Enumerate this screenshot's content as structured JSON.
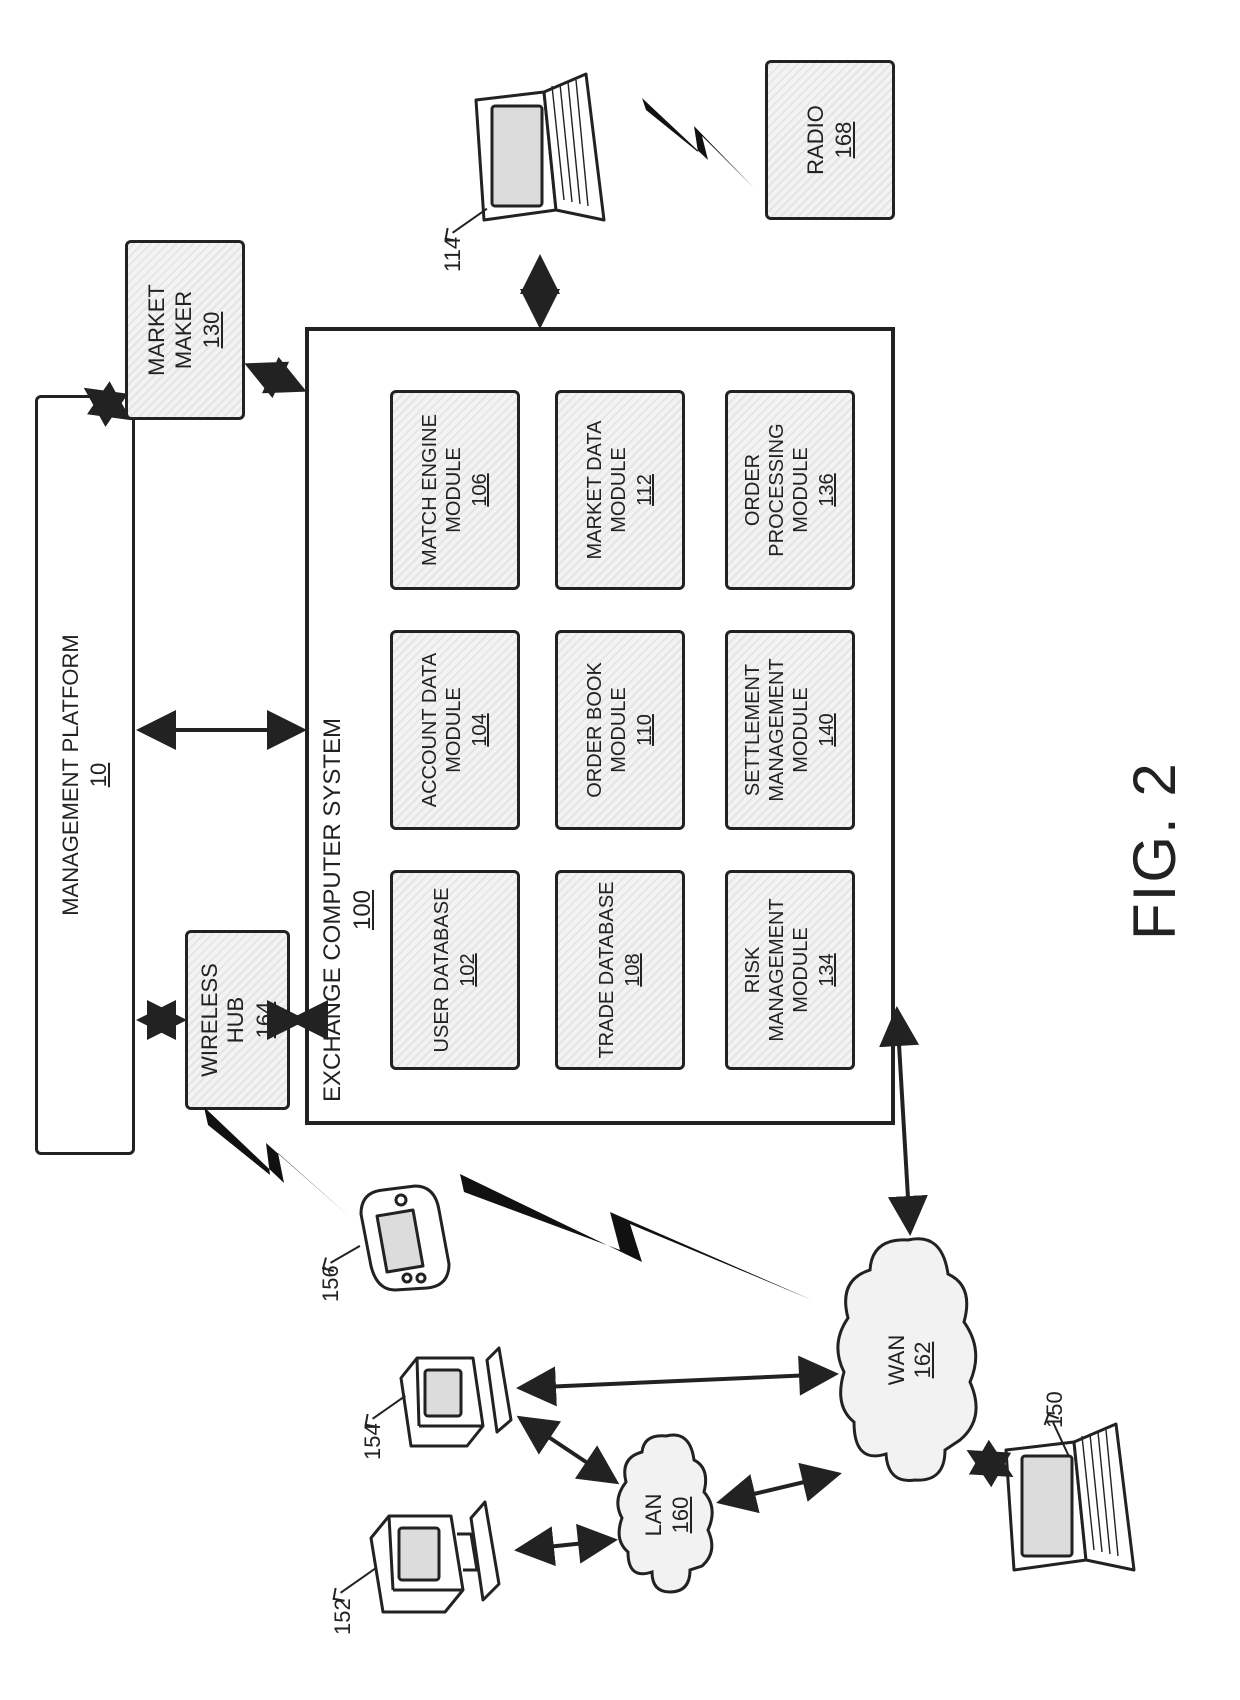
{
  "figure_label": "FIG. 2",
  "management_platform": {
    "label": "MANAGEMENT PLATFORM",
    "num": "10"
  },
  "wireless_hub": {
    "label": "WIRELESS HUB",
    "num": "164"
  },
  "market_maker": {
    "label": "MARKET MAKER",
    "num": "130"
  },
  "radio": {
    "label": "RADIO",
    "num": "168"
  },
  "ecs": {
    "label": "EXCHANGE COMPUTER SYSTEM",
    "num": "100"
  },
  "modules": {
    "user_db": {
      "label": "USER DATABASE",
      "num": "102"
    },
    "account_data": {
      "label": "ACCOUNT DATA MODULE",
      "num": "104"
    },
    "match_engine": {
      "label": "MATCH ENGINE MODULE",
      "num": "106"
    },
    "trade_db": {
      "label": "TRADE DATABASE",
      "num": "108"
    },
    "order_book": {
      "label": "ORDER BOOK MODULE",
      "num": "110"
    },
    "market_data": {
      "label": "MARKET DATA MODULE",
      "num": "112"
    },
    "risk_mgmt": {
      "label": "RISK MANAGEMENT MODULE",
      "num": "134"
    },
    "settlement": {
      "label": "SETTLEMENT MANAGEMENT MODULE",
      "num": "140"
    },
    "order_proc": {
      "label": "ORDER PROCESSING MODULE",
      "num": "136"
    }
  },
  "lan": {
    "label": "LAN",
    "num": "160"
  },
  "wan": {
    "label": "WAN",
    "num": "162"
  },
  "leads": {
    "desktop_152": "152",
    "desktop_154": "154",
    "pda_156": "156",
    "laptop_114": "114",
    "laptop_150": "150"
  }
}
